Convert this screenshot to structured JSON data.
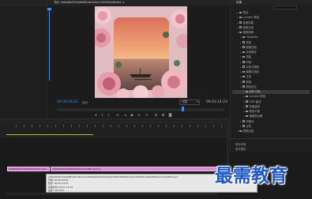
{
  "monitor": {
    "tab_text": "节目: 2d4ab8a0f7a9d6b8f1a61d5e3c7b2f90a4d8c6e1 ≡",
    "timecode": "00:00:26:22",
    "fit_label": "适合",
    "quality": "完整",
    "duration": "00:01:14:23"
  },
  "project": {
    "tab_label": "效果",
    "tree": [
      {
        "label": "预设",
        "indent": 1,
        "expanded": false
      },
      {
        "label": "Lumetri 预设",
        "indent": 1,
        "expanded": false
      },
      {
        "label": "音频效果",
        "indent": 1,
        "expanded": false
      },
      {
        "label": "音频过渡",
        "indent": 1,
        "expanded": false
      },
      {
        "label": "视频效果",
        "indent": 1,
        "expanded": true
      },
      {
        "label": "Obsolete",
        "indent": 2,
        "expanded": false
      },
      {
        "label": "变换",
        "indent": 2,
        "expanded": false
      },
      {
        "label": "图像控制",
        "indent": 2,
        "expanded": false
      },
      {
        "label": "实用程序",
        "indent": 2,
        "expanded": false
      },
      {
        "label": "扭曲",
        "indent": 2,
        "expanded": false
      },
      {
        "label": "时间",
        "indent": 2,
        "expanded": false
      },
      {
        "label": "杂色与颗粒",
        "indent": 2,
        "expanded": false
      },
      {
        "label": "模糊与锐化",
        "indent": 2,
        "expanded": false
      },
      {
        "label": "生成",
        "indent": 2,
        "expanded": false
      },
      {
        "label": "视频",
        "indent": 2,
        "expanded": false
      },
      {
        "label": "颜色校正",
        "indent": 2,
        "expanded": true
      },
      {
        "label": "ASC CDL",
        "indent": 3,
        "expanded": false,
        "selected": true
      },
      {
        "label": "Lumetri 颜色",
        "indent": 3,
        "expanded": false
      },
      {
        "label": "RGB 曲线",
        "indent": 3,
        "expanded": false
      },
      {
        "label": "亮度曲线",
        "indent": 3,
        "expanded": false
      },
      {
        "label": "颜色平衡",
        "indent": 3,
        "expanded": false
      },
      {
        "label": "通道混合器",
        "indent": 3,
        "expanded": false
      },
      {
        "label": "风格化",
        "indent": 2,
        "expanded": false
      },
      {
        "label": "过时",
        "indent": 2,
        "expanded": false
      },
      {
        "label": "视频过渡",
        "indent": 1,
        "expanded": false
      }
    ],
    "bottom_lines": [
      "基本声音",
      "基本图形"
    ]
  },
  "timeline": {
    "clip1_label": "2d4ab8a0f7a9d6b8f1a61d5e3c.mp4",
    "clip2_label": "2d4ab8a0f7a9d6b8f1a61d5e3c7b2f90.mp4 [V]"
  },
  "tooltip": {
    "lines": [
      "2d4ab8a0f7a9d6b8f1a61d5e3c7b2f90a4d8c6e1f2a3b4c5d6e7f8a9b0c1d2e3f4a5b6c7d8e9f0a1b2c3d4e5f6.mp4",
      "开始: 00:00:00:00",
      "结束: 00:01:14:23",
      "持续时间: 00:01:14:24",
      "速度: 100.00%"
    ]
  },
  "watermark": {
    "text": "最需教育"
  },
  "colors": {
    "accent_blue": "#3a8ff0",
    "clip_pink": "#d88ad1",
    "watermark_blue": "#1f57c4"
  }
}
